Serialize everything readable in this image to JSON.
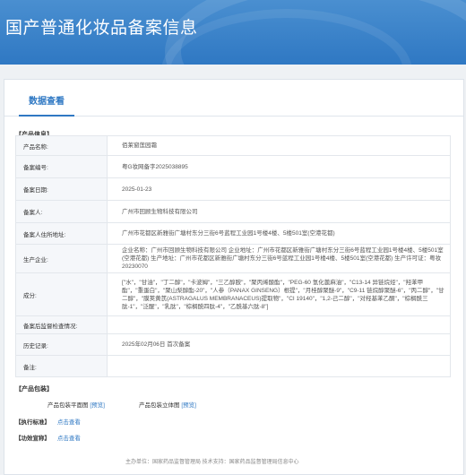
{
  "header": {
    "title": "国产普通化妆品备案信息"
  },
  "tab": {
    "label": "数据查看"
  },
  "sections": {
    "product_info": "【产品信息】",
    "product_package": "【产品包装】",
    "standard": "【执行标准】",
    "efficacy": "【功效宣称】"
  },
  "rows": [
    {
      "key": "产品名称:",
      "value": "佰莱窗莲园霜"
    },
    {
      "key": "备案编号:",
      "value": "粤G妆网备字2025038895"
    },
    {
      "key": "备案日期:",
      "value": "2025-01-23"
    },
    {
      "key": "备案人:",
      "value": "广州市回顾生物科技有限公司"
    },
    {
      "key": "备案人住所地址:",
      "value": "广州市花都区新雅街广塘村东分三街6号蓝程工业园1号楼4楼、5楼501室(空港花都)"
    },
    {
      "key": "生产企业:",
      "value": "企业名称：广州市回顾生物科技有限公司 企业地址：广州市花都区新雅街广塘村东分三街6号蓝程工业园1号楼4楼、5楼501室(空港花都) 生产地址：广州市花都区新雅街广塘村东分三街6号蓝程工业园1号楼4楼、5楼501室(空港花都) 生产许可证：粤妆20230070"
    },
    {
      "key": "成分:",
      "value": "[\"水\"，\"甘油\"，\"丁二醇\"，\"卡波姆\"，\"三乙醇胺\"，\"聚丙烯酸酯\"，\"PEG-60 氢化蓖麻油\"，\"C13-14 异链烷烃\"，\"羟苯甲酯\"，\"重蛋白\"，\"聚山梨醇酯-20\"，\"人参（PANAX GINSENG）根提\"，\"月桂醇聚醚-9\"，\"C9-11 链烷醇聚醚-6\"，\"丙二醇\"，\"甘二醇\"，\"膜荚黄芪(ASTRAGALUS MEMBRANACEUS)提取物\"，\"CI 19140\"，\"1,2-己二醇\"，\"对羟基苯乙酮\"，\"棕榈酰三肽-1\"，\"泛醌\"，\"乳肽\"，\"棕榈酰四肽-4\"，\"乙酰基六肽-8\"]"
    },
    {
      "key": "备案后监督检查情况:",
      "value": ""
    },
    {
      "key": "历史记录:",
      "value": "2025年02月06日 首次备案"
    },
    {
      "key": "备注:",
      "value": ""
    }
  ],
  "package": {
    "flat_label": "产品包装平面图",
    "flat_link": "[预览]",
    "stereo_label": "产品包装立体图",
    "stereo_link": "[预览]"
  },
  "standard_link": "点击查看",
  "efficacy_link": "点击查看",
  "footer_text": "主办单位：国家药品监督管理局   技术支持：国家药品监督管理局信息中心"
}
